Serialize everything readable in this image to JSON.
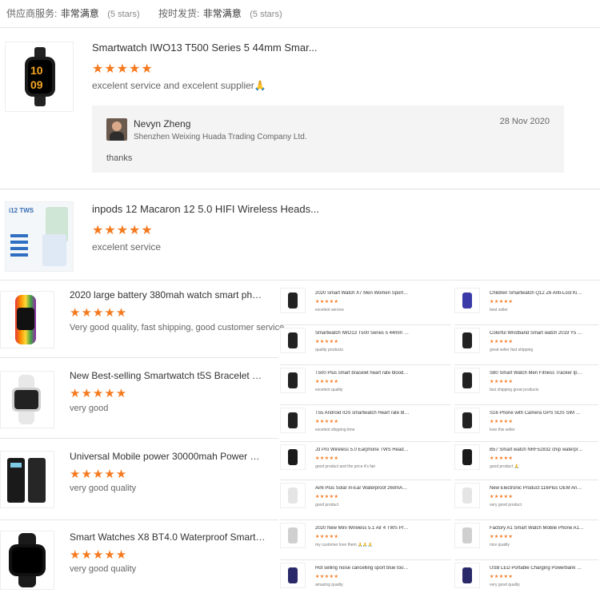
{
  "ratings": [
    {
      "label": "供应商服务:",
      "value": "非常满意",
      "sub": "(5 stars)"
    },
    {
      "label": "按时发货:",
      "value": "非常满意",
      "sub": "(5 stars)"
    }
  ],
  "reviews": [
    {
      "title": "Smartwatch IWO13 T500 Series 5 44mm Smar...",
      "stars": "★★★★★",
      "text": "excelent service and excelent supplier🙏",
      "reply": {
        "name": "Nevyn Zheng",
        "company": "Shenzhen Weixing Huada Trading Company Ltd.",
        "date": "28 Nov 2020",
        "message": "thanks"
      }
    },
    {
      "title": "inpods 12 Macaron 12 5.0 HIFI Wireless Heads...",
      "stars": "★★★★★",
      "text": "excelent service",
      "thumb_label": "i12 TWS"
    }
  ],
  "left_list": [
    {
      "title": "2020 large battery 380mah watch smart phone...",
      "stars": "★★★★★",
      "text": "Very good quality, fast shipping, good customer service"
    },
    {
      "title": "New Best-selling Smartwatch t5S Bracelet Blu...",
      "stars": "★★★★★",
      "text": "very good"
    },
    {
      "title": "Universal Mobile power 30000mah Power Ban...",
      "stars": "★★★★★",
      "text": "very good quality"
    },
    {
      "title": "Smart Watches X8 BT4.0 Waterproof Smartwat...",
      "stars": "★★★★★",
      "text": "very good quality"
    }
  ],
  "grid_col1": [
    {
      "title": "2020 Smart Watch X7 Men Women Sports Fitn...",
      "stars": "★★★★★",
      "text": "excelent service"
    },
    {
      "title": "Smartwatch IWO13 T500 Series 5 44mm Smar...",
      "stars": "★★★★★",
      "text": "quality products"
    },
    {
      "title": "T500 Plus smart bracelet heart rate blood pres...",
      "stars": "★★★★★",
      "text": "excelent quality"
    },
    {
      "title": "T55 Android IOS smartwatch Heart rate blood ...",
      "stars": "★★★★★",
      "text": "excelent shipping time"
    },
    {
      "title": "J3 Pro Wireless 5.0 Earphone TWS Headphone...",
      "stars": "★★★★★",
      "text": "good product and the price it's fair"
    },
    {
      "title": "Air6 Plus Solar in-Ear Waterproof 260mAh Cha...",
      "stars": "★★★★★",
      "text": "good product"
    },
    {
      "title": "2020 New Mini Wireless 5.1 Air 4 TWS Pro 5 Ea...",
      "stars": "★★★★★",
      "text": "my customer love them 🙏🙏🙏"
    },
    {
      "title": "Hot selling noise cancelling sport blue tooth wi...",
      "stars": "★★★★★",
      "text": "amazing quality"
    }
  ],
  "grid_col2": [
    {
      "title": "Children Smartwatch Q12 Z6 Anti-Lost Kid 1.4...",
      "stars": "★★★★★",
      "text": "best seller"
    },
    {
      "title": "Colorful Wristband Smart watch 2019 Y5 Kids ...",
      "stars": "★★★★★",
      "text": "great seller   fast shipping"
    },
    {
      "title": "S80 Smart Watch Men Fitness Tracker Ip68 Wa...",
      "stars": "★★★★★",
      "text": "fast shipping   great products"
    },
    {
      "title": "S16 Phone with Camera GPS SOS SIM Card Ca...",
      "stars": "★★★★★",
      "text": "love this seller"
    },
    {
      "title": "B57 Smart watch NRF52832 chip waterproof I...",
      "stars": "★★★★★",
      "text": "good product 🙏"
    },
    {
      "title": "New Electronic Product 116Plus OEM Android ...",
      "stars": "★★★★★",
      "text": "very good product"
    },
    {
      "title": "Factory A1 Smart Watch Mobile Phone A1 Sma...",
      "stars": "★★★★★",
      "text": "nice quality"
    },
    {
      "title": "USB LED Portable Charging Powerbank Pack C...",
      "stars": "★★★★★",
      "text": "very good quality"
    }
  ]
}
